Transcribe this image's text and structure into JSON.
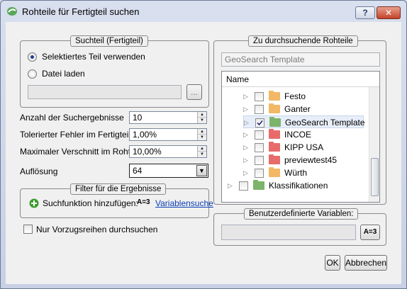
{
  "window": {
    "title": "Rohteile für Fertigteil suchen",
    "help_label": "?",
    "close_label": "✕"
  },
  "suchteil": {
    "legend": "Suchteil (Fertigteil)",
    "option_selected": "Selektiertes Teil verwenden",
    "option_file": "Datei laden",
    "browse_label": "..."
  },
  "params": {
    "count_label": "Anzahl der Suchergebnisse",
    "count_value": "10",
    "tolerance_label": "Tolerierter Fehler im Fertigteil",
    "tolerance_value": "1,00%",
    "waste_label": "Maximaler Verschnitt im Rohteil",
    "waste_value": "10,00%",
    "resolution_label": "Auflösung",
    "resolution_value": "64"
  },
  "filter": {
    "legend": "Filter für die Ergebnisse",
    "add_label": "Suchfunktion hinzufügen:",
    "var_icon": "A=3",
    "var_link": "Variablensuche"
  },
  "only_preferred_label": "Nur Vorzugsreihen durchsuchen",
  "rohteile": {
    "legend": "Zu durchsuchende Rohteile",
    "search_value": "GeoSearch Template",
    "column_name": "Name",
    "items": [
      {
        "label": "Festo",
        "checked": false,
        "color": "#f2b866"
      },
      {
        "label": "Ganter",
        "checked": false,
        "color": "#f2b866"
      },
      {
        "label": "GeoSearch Template",
        "checked": true,
        "color": "#7cb46a"
      },
      {
        "label": "INCOE",
        "checked": false,
        "color": "#e86b6b"
      },
      {
        "label": "KIPP USA",
        "checked": false,
        "color": "#e86b6b"
      },
      {
        "label": "previewtest45",
        "checked": false,
        "color": "#e86b6b"
      },
      {
        "label": "Würth",
        "checked": false,
        "color": "#f2b866"
      }
    ],
    "root": {
      "label": "Klassifikationen",
      "checked": false,
      "color": "#7cb46a"
    }
  },
  "custom_vars": {
    "legend": "Benutzerdefinierte Variablen:",
    "btn_icon": "A=3"
  },
  "buttons": {
    "ok": "OK",
    "cancel": "Abbrechen"
  }
}
